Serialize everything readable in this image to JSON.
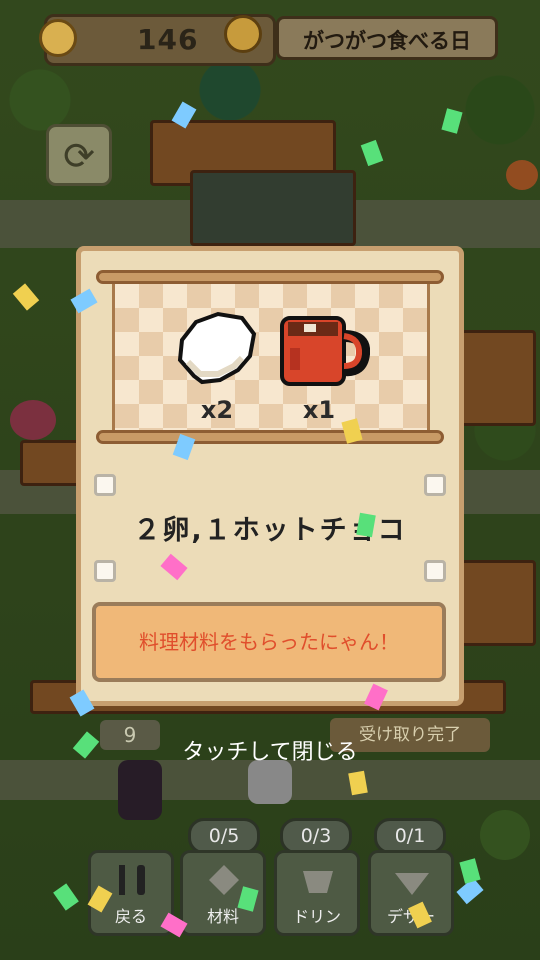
{
  "hud": {
    "coins": "146",
    "event_title": "がつがつ食べる日",
    "refresh_icon": "refresh-icon"
  },
  "background": {
    "counter": "9",
    "status": "受け取り完了"
  },
  "reward_panel": {
    "items": [
      {
        "name": "egg",
        "icon": "egg-icon",
        "quantity": "x2"
      },
      {
        "name": "hot-chocolate",
        "icon": "mug-icon",
        "quantity": "x1"
      }
    ],
    "summary": "２卵,１ホットチョコ",
    "message": "料理材料をもらったにゃん！"
  },
  "close_hint": "タッチして閉じる",
  "bottom_tabs": [
    {
      "label": "戻る",
      "count": "",
      "icon": "back-cutlery-icon"
    },
    {
      "label": "材料",
      "count": "0/5",
      "icon": "ingredient-icon"
    },
    {
      "label": "ドリン",
      "count": "0/3",
      "icon": "drink-icon"
    },
    {
      "label": "デザー",
      "count": "0/1",
      "icon": "dessert-icon"
    }
  ],
  "colors": {
    "panel": "#ecdcb8",
    "message_text": "#e04e2c",
    "message_bg": "#f0b878"
  }
}
